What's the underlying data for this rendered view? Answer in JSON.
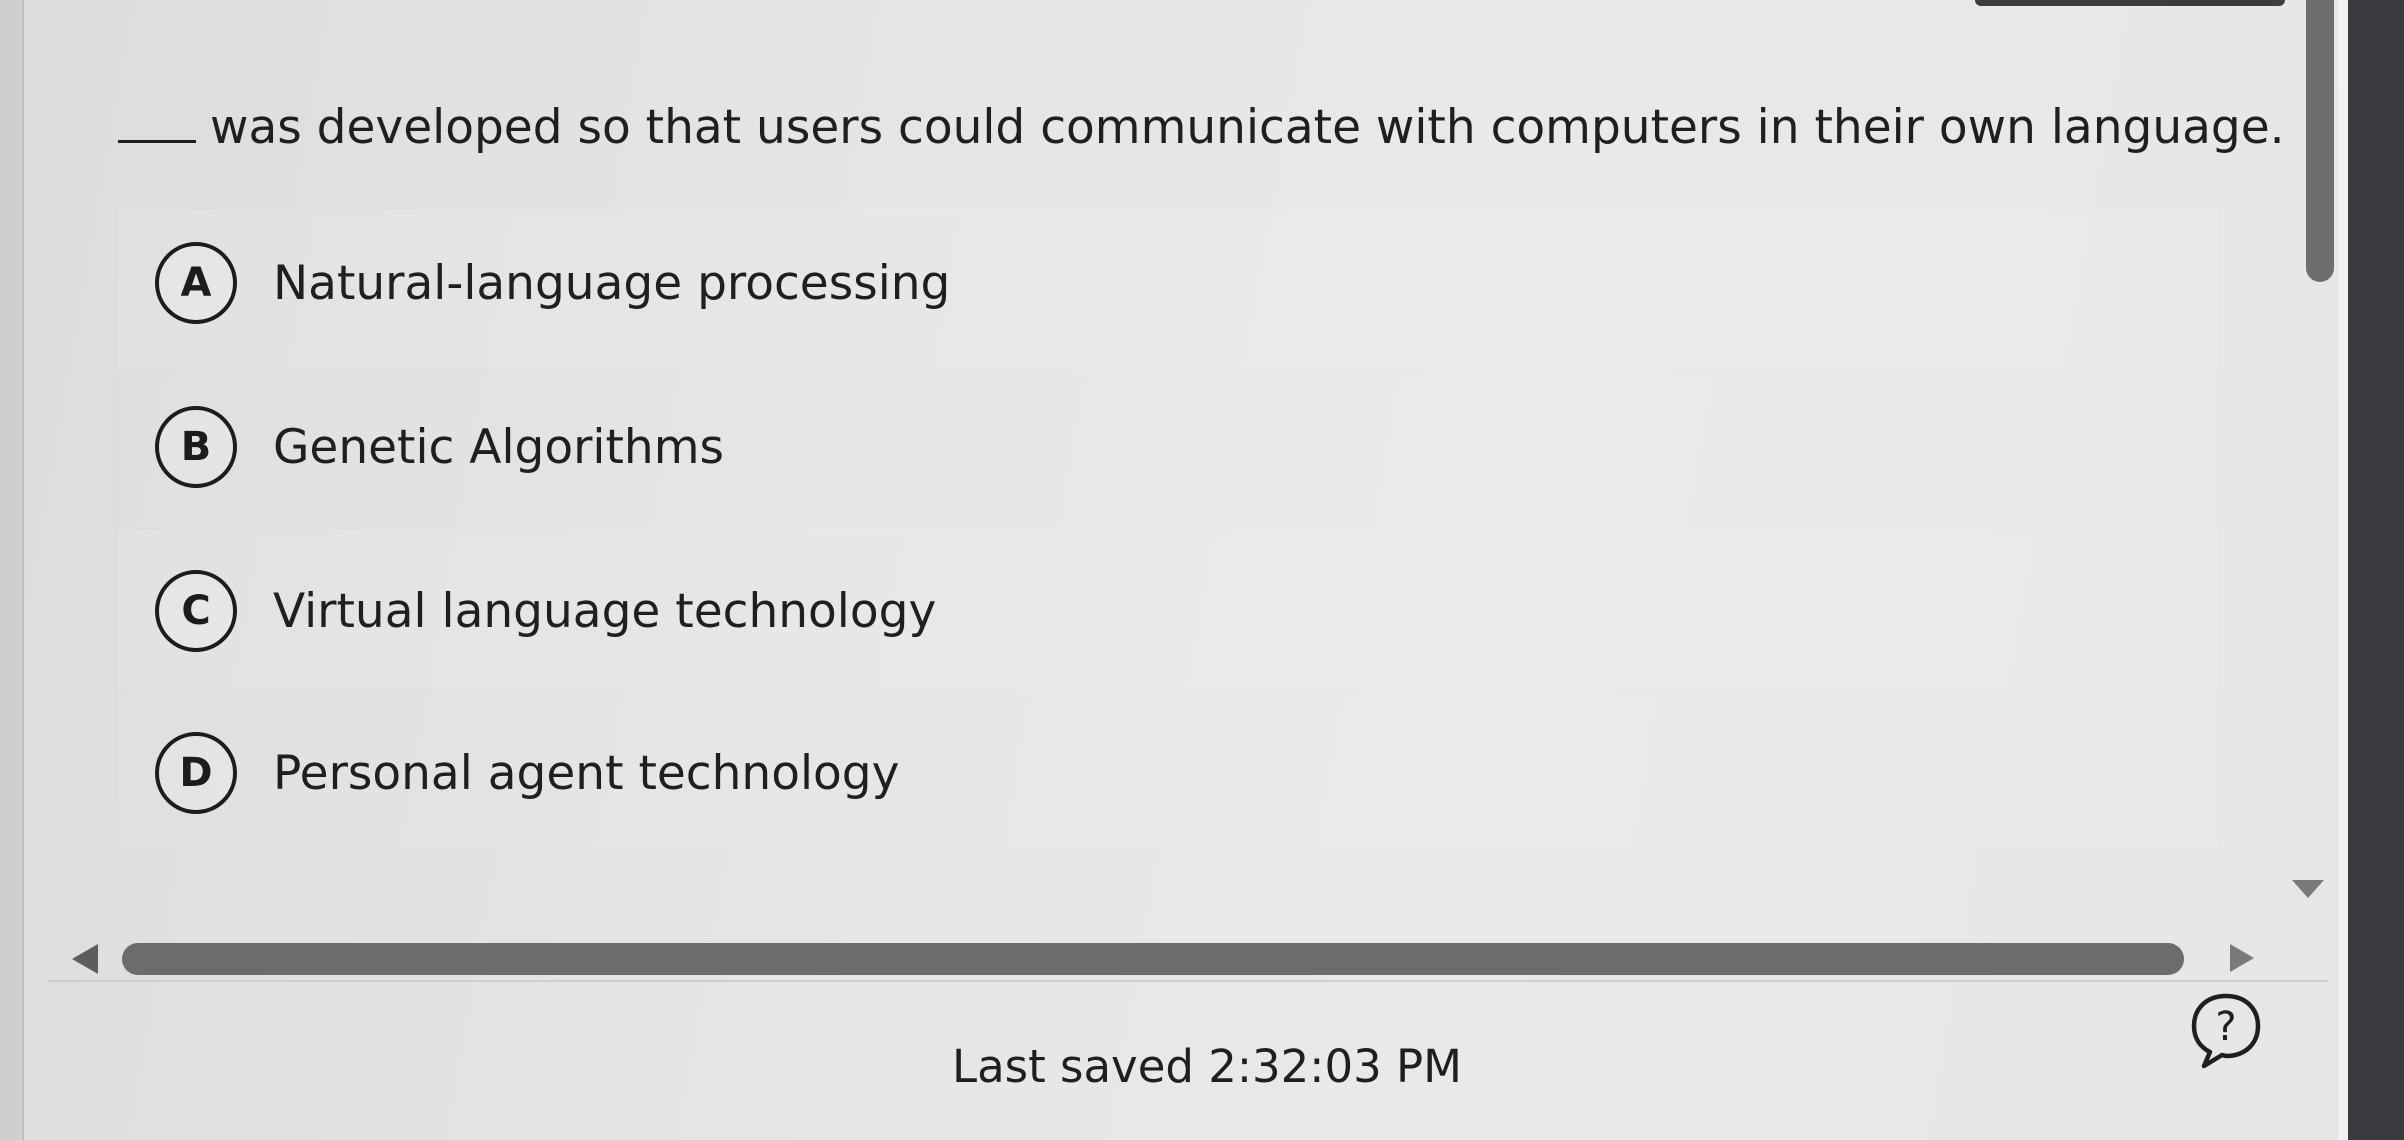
{
  "question": {
    "text": "was developed so that users could communicate with computers in their own language."
  },
  "options": [
    {
      "letter": "A",
      "label": "Natural-language processing"
    },
    {
      "letter": "B",
      "label": "Genetic Algorithms"
    },
    {
      "letter": "C",
      "label": "Virtual language technology"
    },
    {
      "letter": "D",
      "label": "Personal agent technology"
    }
  ],
  "footer": {
    "last_saved": "Last saved 2:32:03 PM",
    "help_icon": "question-bubble-icon"
  },
  "icons": {
    "scroll_left": "triangle-left-icon",
    "scroll_right": "triangle-right-icon",
    "scroll_down": "triangle-down-icon"
  }
}
